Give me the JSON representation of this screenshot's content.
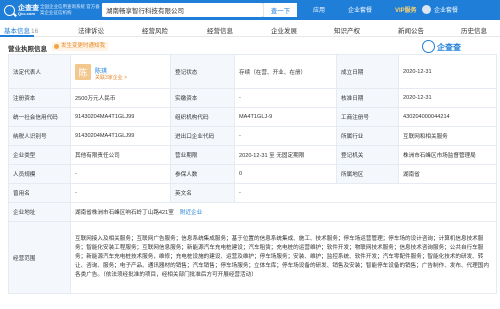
{
  "header": {
    "logo_text": "企查查",
    "logo_sub": "Qcc.com",
    "slogan": "全国企业信用查询系统 官方备案企业征信机构",
    "search_value": "湖南畅享智行科技有限公司",
    "search_button": "查一下",
    "nav": [
      "应用",
      "企业套餐",
      "VIP服务"
    ],
    "user_name": "企业套餐"
  },
  "tabs": [
    {
      "label": "基本信息",
      "count": "16"
    },
    {
      "label": "法律诉讼",
      "count": ""
    },
    {
      "label": "经营风险",
      "count": ""
    },
    {
      "label": "经营信息",
      "count": ""
    },
    {
      "label": "企业发展",
      "count": ""
    },
    {
      "label": "知识产权",
      "count": ""
    },
    {
      "label": "新闻公告",
      "count": ""
    },
    {
      "label": "历史信息",
      "count": ""
    }
  ],
  "section": {
    "title": "营业执照信息",
    "badge": "发生变更时通知我",
    "watermark": "企查查"
  },
  "table": {
    "legal_rep_label": "法定代表人",
    "rep_avatar_char": "陈",
    "rep_name": "陈琪",
    "rep_link": "关联3家企业 >",
    "reg_status_label": "登记状态",
    "reg_status_value": "存续（在营、开业、在册）",
    "founded_label": "成立日期",
    "founded_value": "2020-12-31",
    "reg_cap_label": "注册资本",
    "reg_cap_value": "2500万元人民币",
    "paid_cap_label": "实缴资本",
    "paid_cap_value": "-",
    "approval_label": "核准日期",
    "approval_value": "2020-12-31",
    "credit_code_label": "统一社会信用代码",
    "credit_code_value": "91430204MA4T1GLJ99",
    "org_code_label": "组织机构代码",
    "org_code_value": "MA4T1GLJ-9",
    "biz_reg_label": "工商注册号",
    "biz_reg_value": "430204000044214",
    "taxpayer_label": "纳税人识别号",
    "taxpayer_value": "91430204MA4T1GLJ99",
    "import_code_label": "进出口企业代码",
    "import_code_value": "-",
    "industry_label": "所属行业",
    "industry_value": "互联网和相关服务",
    "type_label": "企业类型",
    "type_value": "其他有限责任公司",
    "term_label": "营业期限",
    "term_value": "2020-12-31 至 无固定期限",
    "authority_label": "登记机关",
    "authority_value": "株洲市石峰区市场监督管理局",
    "staff_label": "人员规模",
    "staff_value": "-",
    "insured_label": "参保人数",
    "insured_value": "0",
    "region_label": "所属地区",
    "region_value": "湖南省",
    "former_label": "曾用名",
    "former_value": "-",
    "english_label": "英文名",
    "english_value": "-",
    "address_label": "企业地址",
    "address_value": "湖南省株洲市石峰区响石岭丁山路421室",
    "address_link": "附近企业",
    "scope_label": "经营范围",
    "scope_value": "互联网接入及相关服务；互联网广告服务；信息系统集成服务；基于位置的信息系统集成、施工、技术服务；停车场运营管理；停车场的设计咨询；计算机信息技术服务；智能化安装工程服务；互联网信息服务；新能源汽车充电桩建设；汽车租赁；充电桩的运营维护；软件开发；物联网技术服务；信息技术咨询服务；公共自行车服务；新能源汽车充电桩技术服务，维修；充电桩设施的建设、运营及维护；停车场服务；安装、维护；监控系统、软件开发；汽车零配件服务；智能化技术的研发、转让、咨询、服务；电子产品、通讯器材的销售；汽车销售；停车场服务；立体车库；停车场设备的研发、销售及安装；智能停车设备的销售；广告制作、发布、代理国内各类广告。（依法须经批准的项目，经相关部门批准后方可开展经营活动）"
  }
}
